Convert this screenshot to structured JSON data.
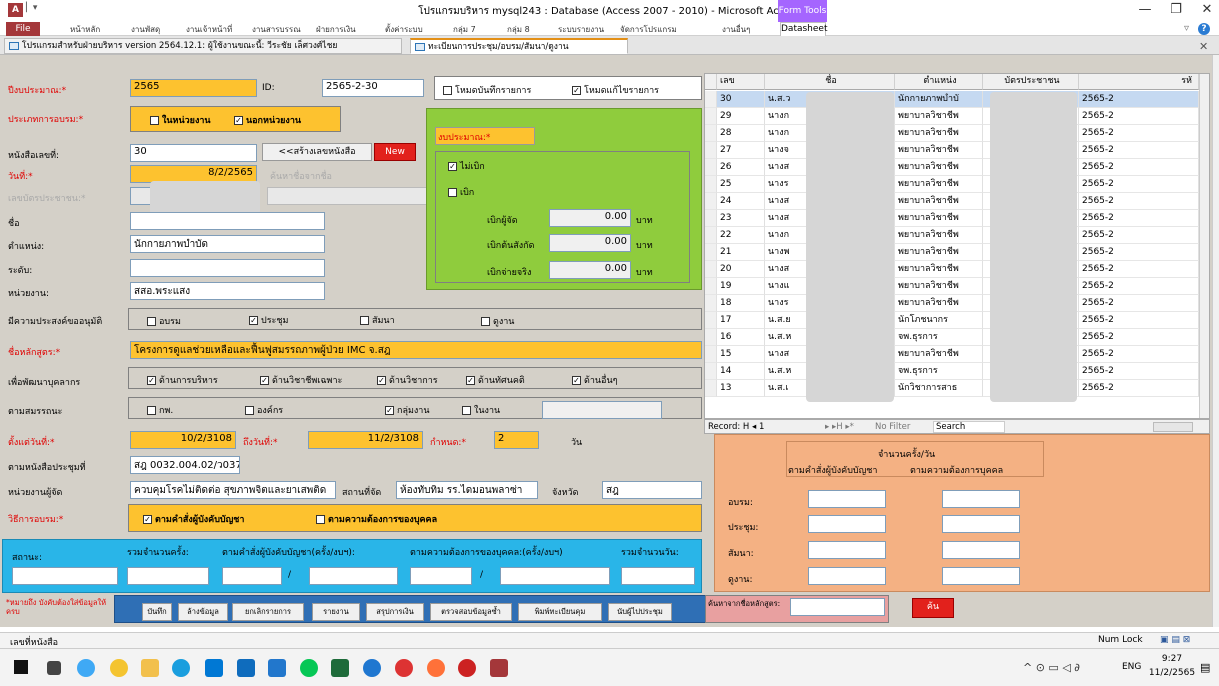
{
  "window": {
    "title": "โปรแกรมบริหาร mysql243 : Database (Access 2007 - 2010)  -  Microsoft Access",
    "app_icon": "A",
    "form_tools": "Form Tools",
    "minimize": "—",
    "restore": "❐",
    "close": "✕",
    "help": "?"
  },
  "ribbon": {
    "file": "File",
    "tabs": [
      "หน้าหลัก",
      "งานพัสดุ",
      "งานเจ้าหน้าที่",
      "งานสารบรรณ",
      "ฝ่ายการเงิน",
      "ตั้งค่าระบบ",
      "กลุ่ม 7",
      "กลุ่ม 8",
      "ระบบรายงาน",
      "จัดการโปรแกรม",
      "งานอื่นๆ"
    ],
    "datasheet": "Datasheet"
  },
  "doc_tabs": [
    "โปรแกรมสำหรับฝ่ายบริหาร version 2564.12.1: ผู้ใช้งานขณะนี้: วีระชัย เล็ศวงศ์ไชย",
    "ทะเบียนการประชุม/อบรม/สัมนา/ดูงาน"
  ],
  "form": {
    "budget_year_label": "ปีงบประมาณ:*",
    "budget_year": "2565",
    "id_label": "ID:",
    "id_value": "2565-2-30",
    "mode_delete": "โหมดบันทึกรายการ",
    "mode_edit": "โหมดแก้ไขรายการ",
    "training_type_label": "ประเภทการอบรม:*",
    "inside": "ในหน่วยงาน",
    "outside": "นอกหน่วยงาน",
    "book_no_label": "หนังสือเลขที่:",
    "book_no": "30",
    "create_no_btn": "<<สร้างเลขหนังสือ",
    "new_btn": "New",
    "date_label": "วันที่:*",
    "date_value": "8/2/2565",
    "search_name_hint": "ค้นหาชื่อจากชื่อ",
    "citizen_label": "เลขบัตรประชาชน:*",
    "name_label": "ชื่อ",
    "position_label": "ตำแหน่ง:",
    "position": "นักกายภาพบำบัด",
    "level_label": "ระดับ:",
    "unit_label": "หน่วยงาน:",
    "unit": "สสอ.พระแสง",
    "purpose_label": "มีความประสงค์ขออนุมัติ",
    "p_train": "อบรม",
    "p_meet": "ประชุม",
    "p_seminar": "สัมนา",
    "p_visit": "ดูงาน",
    "course_label": "ชื่อหลักสูตร:*",
    "course": "โครงการดูแลช่วยเหลือและฟื้นฟูสมรรถภาพผู้ป่วย IMC จ.สฎ",
    "develop_label": "เพื่อพัฒนาบุคลากร",
    "d1": "ด้านการบริหาร",
    "d2": "ด้านวิชาชีพเฉพาะ",
    "d3": "ด้านวิชาการ",
    "d4": "ด้านทัศนคติ",
    "d5": "ด้านอื่นๆ",
    "competency_label": "ตามสมรรถนะ",
    "c1": "กพ.",
    "c2": "องค์กร",
    "c3": "กลุ่มงาน",
    "c4": "ในงาน",
    "from_label": "ตั้งแต่วันที่:*",
    "from_date": "10/2/3108",
    "to_label": "ถึงวันที่:*",
    "to_date": "11/2/3108",
    "duration_label": "กำหนด:*",
    "duration": "2",
    "day_unit": "วัน",
    "per_book_label": "ตามหนังสือประชุมที่",
    "per_book": "สฎ 0032.004.02/ว037",
    "organizer_label": "หน่วยงานผู้จัด",
    "organizer": "ควบคุมโรคไม่ติดต่อ สุขภาพจิตและยาเสพติด",
    "venue_label": "สถานที่จัด",
    "venue": "ห้องทับทิม รร.ไดมอนพลาซ่า",
    "province_label": "จังหวัด",
    "province": "สฎ",
    "method_label": "วิธีการอบรม:*",
    "m1": "ตามคำสั่งผู้บังคับบัญชา",
    "m2": "ตามความต้องการของบุคคล",
    "status_label": "สถานะ:",
    "total_times_label": "รวมจำนวนครั้ง:",
    "by_order_label": "ตามคำสั่งผู้บังคับบัญชา(ครั้ง/งบฯ):",
    "by_need_label": "ตามความต้องการของบุคคล:(ครั้ง/งบฯ)",
    "total_days_label": "รวมจำนวนวัน:",
    "note": "*หมายถึง บังคับต้องใส่ข้อมูลให้ครบ"
  },
  "budget": {
    "label": "งบประมาณ:*",
    "no_withdraw": "ไม่เบิก",
    "withdraw": "เบิก",
    "w_org": "เบิกผู้จัด",
    "w_own": "เบิกต้นสังกัด",
    "w_actual": "เบิกจ่ายจริง",
    "w_org_val": "0.00",
    "w_own_val": "0.00",
    "w_actual_val": "0.00",
    "baht": "บาท"
  },
  "counts": {
    "title": "จำนวนครั้ง/วัน",
    "col1": "ตามคำสั่งผู้บังคับบัญชา",
    "col2": "ตามความต้องการบุคคล",
    "rows": [
      "อบรม:",
      "ประชุม:",
      "สัมนา:",
      "ดูงาน:"
    ]
  },
  "buttons": [
    "บันทึก",
    "ล้างข้อมูล",
    "ยกเลิกรายการ",
    "รายงาน",
    "สรุปการเงิน",
    "ตรวจสอบข้อมูลซ้ำ",
    "พิมพ์ทะเบียนคุม",
    "นับผู้ไปประชุม"
  ],
  "course_search_label": "ค้นหาจากชื่อหลักสูตร:",
  "search_btn": "ค้น",
  "grid": {
    "headers": [
      "เลข",
      "ชื่อ",
      "ตำแหน่ง",
      "บัตรประชาชน",
      "รหั"
    ],
    "rows": [
      [
        "30",
        "น.ส.ว",
        "นักกายภาพบำบั",
        "",
        "2565-2"
      ],
      [
        "29",
        "นางก",
        "พยาบาลวิชาชีพ",
        "",
        "2565-2"
      ],
      [
        "28",
        "นางก",
        "พยาบาลวิชาชีพ",
        "",
        "2565-2"
      ],
      [
        "27",
        "นางจ",
        "พยาบาลวิชาชีพ",
        "",
        "2565-2"
      ],
      [
        "26",
        "นางส",
        "พยาบาลวิชาชีพ",
        "",
        "2565-2"
      ],
      [
        "25",
        "นางร",
        "พยาบาลวิชาชีพ",
        "",
        "2565-2"
      ],
      [
        "24",
        "นางส",
        "พยาบาลวิชาชีพ",
        "",
        "2565-2"
      ],
      [
        "23",
        "นางส",
        "พยาบาลวิชาชีพ",
        "",
        "2565-2"
      ],
      [
        "22",
        "นางก",
        "พยาบาลวิชาชีพ",
        "",
        "2565-2"
      ],
      [
        "21",
        "นางพ",
        "พยาบาลวิชาชีพ",
        "",
        "2565-2"
      ],
      [
        "20",
        "นางส",
        "พยาบาลวิชาชีพ",
        "",
        "2565-2"
      ],
      [
        "19",
        "นางแ",
        "พยาบาลวิชาชีพ",
        "",
        "2565-2"
      ],
      [
        "18",
        "นางร",
        "พยาบาลวิชาชีพ",
        "",
        "2565-2"
      ],
      [
        "17",
        "น.ส.ย",
        "นักโภชนากร",
        "",
        "2565-2"
      ],
      [
        "16",
        "น.ส.ห",
        "จพ.ธุรการ",
        "",
        "2565-2"
      ],
      [
        "15",
        "นางส",
        "พยาบาลวิชาชีพ",
        "",
        "2565-2"
      ],
      [
        "14",
        "น.ส.ห",
        "จพ.ธุรการ",
        "",
        "2565-2"
      ],
      [
        "13",
        "น.ส.เ",
        "นักวิชาการสาธ",
        "",
        "2565-2"
      ]
    ],
    "nav_record": "Record: H  ◂ 1",
    "nav_arrows": "▸  ▸H  ▸*",
    "no_filter": "No Filter",
    "search": "Search"
  },
  "status": {
    "left": "เลขที่หนังสือ",
    "numlock": "Num Lock"
  },
  "taskbar": {
    "lang": "ENG",
    "time": "9:27",
    "date": "11/2/2565"
  }
}
